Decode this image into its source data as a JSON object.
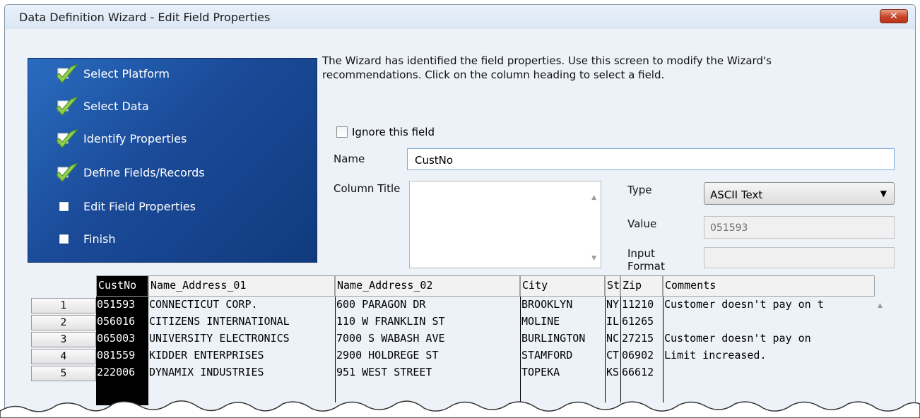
{
  "window": {
    "title": "Data Definition Wizard - Edit Field Properties",
    "close_glyph": "✕"
  },
  "steps": [
    {
      "label": "Select Platform",
      "done": true
    },
    {
      "label": "Select Data",
      "done": true
    },
    {
      "label": "Identify Properties",
      "done": true
    },
    {
      "label": "Define Fields/Records",
      "done": true
    },
    {
      "label": "Edit Field Properties",
      "done": false
    },
    {
      "label": "Finish",
      "done": false
    }
  ],
  "instructions": "The Wizard has identified the field properties. Use this screen to modify the Wizard's recommendations. Click on the column heading to select a field.",
  "form": {
    "ignore_label": "Ignore this field",
    "name_label": "Name",
    "name_value": "CustNo",
    "column_title_label": "Column Title",
    "type_label": "Type",
    "type_value": "ASCII Text",
    "value_label": "Value",
    "value_value": "051593",
    "input_format_label": "Input Format"
  },
  "grid": {
    "columns": [
      "CustNo",
      "Name_Address_01",
      "Name_Address_02",
      "City",
      "St",
      "Zip",
      "Comments"
    ],
    "rows": [
      {
        "num": "1",
        "cells": [
          "051593",
          "CONNECTICUT CORP.",
          "600 PARAGON DR",
          "BROOKLYN",
          "NY",
          "11210",
          "Customer doesn't pay on t"
        ]
      },
      {
        "num": "2",
        "cells": [
          "056016",
          "CITIZENS INTERNATIONAL",
          "110 W FRANKLIN ST",
          "MOLINE",
          "IL",
          "61265",
          ""
        ]
      },
      {
        "num": "3",
        "cells": [
          "065003",
          "UNIVERSITY ELECTRONICS",
          "7000 S WABASH AVE",
          "BURLINGTON",
          "NC",
          "27215",
          " Customer doesn't pay on"
        ]
      },
      {
        "num": "4",
        "cells": [
          "081559",
          "KIDDER ENTERPRISES",
          "2900 HOLDREGE ST",
          "STAMFORD",
          "CT",
          "06902",
          "Limit increased."
        ]
      },
      {
        "num": "5",
        "cells": [
          "222006",
          "DYNAMIX INDUSTRIES",
          "951 WEST STREET",
          "TOPEKA",
          "KS",
          "66612",
          ""
        ]
      }
    ]
  }
}
